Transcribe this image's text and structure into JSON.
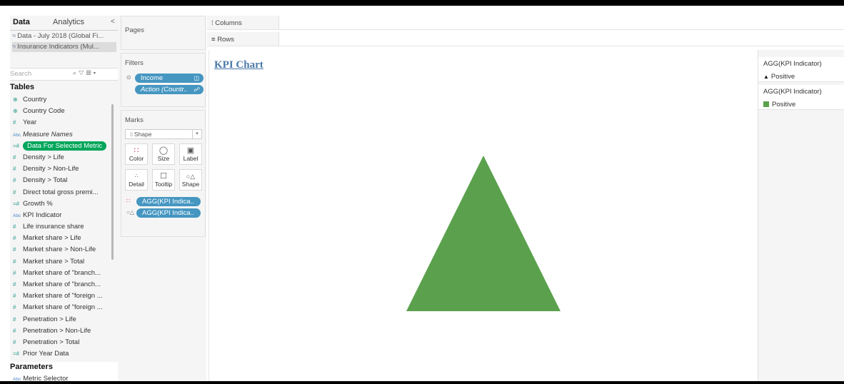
{
  "data_pane": {
    "tabs": [
      "Data",
      "Analytics"
    ],
    "collapse_icon": "chevron-left",
    "data_sources": [
      "Data - July 2018 (Global Fi...",
      "Insurance Indicators (Mul..."
    ],
    "search_placeholder": "Search",
    "tables_title": "Tables",
    "fields": [
      {
        "name": "Country",
        "icon": "globe"
      },
      {
        "name": "Country Code",
        "icon": "globe"
      },
      {
        "name": "Year",
        "icon": "measure"
      },
      {
        "name": "Measure Names",
        "icon": "abc"
      },
      {
        "name": "Data For Selected Metric",
        "icon": "calc-measure"
      },
      {
        "name": "Density > Life",
        "icon": "measure"
      },
      {
        "name": "Density > Non-Life",
        "icon": "measure"
      },
      {
        "name": "Density > Total",
        "icon": "measure"
      },
      {
        "name": "Direct total gross premi...",
        "icon": "measure"
      },
      {
        "name": "Growth %",
        "icon": "calc-measure"
      },
      {
        "name": "KPI Indicator",
        "icon": "abc"
      },
      {
        "name": "Life insurance share",
        "icon": "measure"
      },
      {
        "name": "Market share > Life",
        "icon": "measure"
      },
      {
        "name": "Market share > Non-Life",
        "icon": "measure"
      },
      {
        "name": "Market share > Total",
        "icon": "measure"
      },
      {
        "name": "Market share of \"branch...",
        "icon": "measure"
      },
      {
        "name": "Market share of \"branch...",
        "icon": "measure"
      },
      {
        "name": "Market share of \"foreign ...",
        "icon": "measure"
      },
      {
        "name": "Market share of \"foreign ...",
        "icon": "measure"
      },
      {
        "name": "Penetration > Life",
        "icon": "measure"
      },
      {
        "name": "Penetration > Non-Life",
        "icon": "measure"
      },
      {
        "name": "Penetration > Total",
        "icon": "measure"
      },
      {
        "name": "Prior Year Data",
        "icon": "calc-measure"
      }
    ],
    "parameters_title": "Parameters",
    "parameters": [
      {
        "name": "Metric Selector",
        "icon": "abc"
      }
    ]
  },
  "pages": {
    "title": "Pages"
  },
  "filters": {
    "title": "Filters",
    "items": [
      {
        "label": "Income",
        "suffix_icon": "filter-set"
      },
      {
        "label": "Action (Countr..",
        "suffix_icon": "link"
      }
    ]
  },
  "marks": {
    "title": "Marks",
    "mark_type": "Shape",
    "buttons": [
      "Color",
      "Size",
      "Label",
      "Detail",
      "Tooltip",
      "Shape"
    ],
    "pills": [
      {
        "label": "AGG(KPI Indica..",
        "encoding": "color"
      },
      {
        "label": "AGG(KPI Indica..",
        "encoding": "shape"
      }
    ]
  },
  "shelves": {
    "columns": "Columns",
    "rows": "Rows"
  },
  "view": {
    "title": "KPI Chart",
    "mark": {
      "shape": "triangle-up",
      "color": "#5ba14d",
      "kpi_value": "Positive"
    }
  },
  "legends": [
    {
      "title": "AGG(KPI Indicator)",
      "kind": "shape",
      "items": [
        {
          "label": "Positive",
          "symbol": "▲"
        }
      ]
    },
    {
      "title": "AGG(KPI Indicator)",
      "kind": "color",
      "items": [
        {
          "label": "Positive",
          "color": "#5ba14d"
        }
      ]
    }
  ]
}
